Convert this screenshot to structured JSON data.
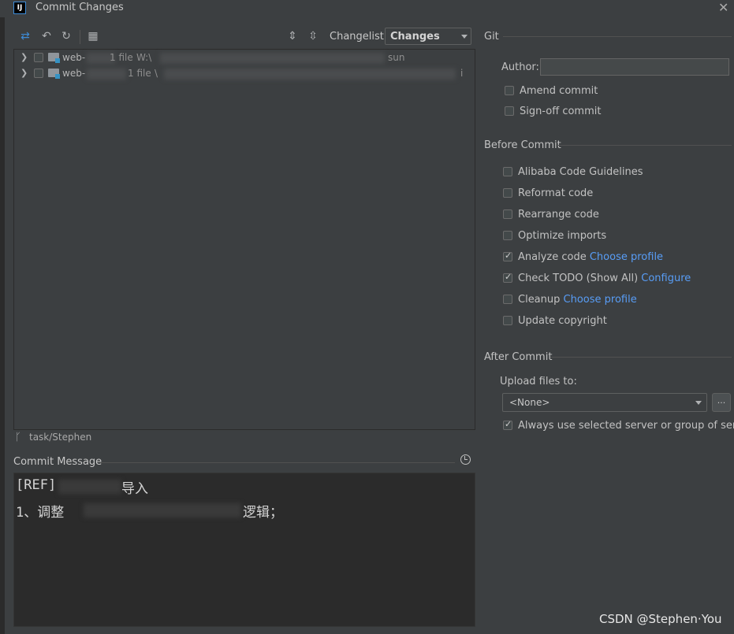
{
  "window": {
    "title": "Commit Changes",
    "logo": "IJ"
  },
  "toolbar": {
    "icons": [
      "arrows-icon",
      "undo-icon",
      "refresh-icon",
      "group-icon",
      "expand-all-icon",
      "collapse-all-icon"
    ],
    "changelist_label": "Changelist:",
    "changelist_value": "Changes"
  },
  "tree": {
    "rows": [
      {
        "name": "web-",
        "count": "1 file",
        "path": "W:\\",
        "suffix": "sun"
      },
      {
        "name": "web-",
        "count": "1 file",
        "path": "\\",
        "suffix": "i"
      }
    ]
  },
  "branch": {
    "name": "task/Stephen"
  },
  "commit_message": {
    "label": "Commit Message",
    "line1_prefix": "[REF]",
    "line1_suffix": "导入",
    "line2_prefix": "1、调整",
    "line2_suffix": "逻辑；"
  },
  "git": {
    "title": "Git",
    "author_label": "Author:",
    "author_value": "",
    "amend_label": "Amend commit",
    "signoff_label": "Sign-off commit"
  },
  "before_commit": {
    "title": "Before Commit",
    "options": [
      {
        "label": "Alibaba Code Guidelines",
        "checked": false,
        "link": ""
      },
      {
        "label": "Reformat code",
        "checked": false,
        "link": ""
      },
      {
        "label": "Rearrange code",
        "checked": false,
        "link": ""
      },
      {
        "label": "Optimize imports",
        "checked": false,
        "link": ""
      },
      {
        "label": "Analyze code",
        "checked": true,
        "link": "Choose profile"
      },
      {
        "label": "Check TODO (Show All)",
        "checked": true,
        "link": "Configure"
      },
      {
        "label": "Cleanup",
        "checked": false,
        "link": "Choose profile"
      },
      {
        "label": "Update copyright",
        "checked": false,
        "link": ""
      }
    ]
  },
  "after_commit": {
    "title": "After Commit",
    "upload_label": "Upload files to:",
    "upload_value": "<None>",
    "browse_label": "...",
    "always_use_label": "Always use selected server or group of servers",
    "always_use_checked": true
  },
  "watermark": "CSDN @Stephen·You",
  "colors": {
    "link": "#589df6",
    "background": "#3c3f41",
    "editor": "#2b2b2b"
  }
}
